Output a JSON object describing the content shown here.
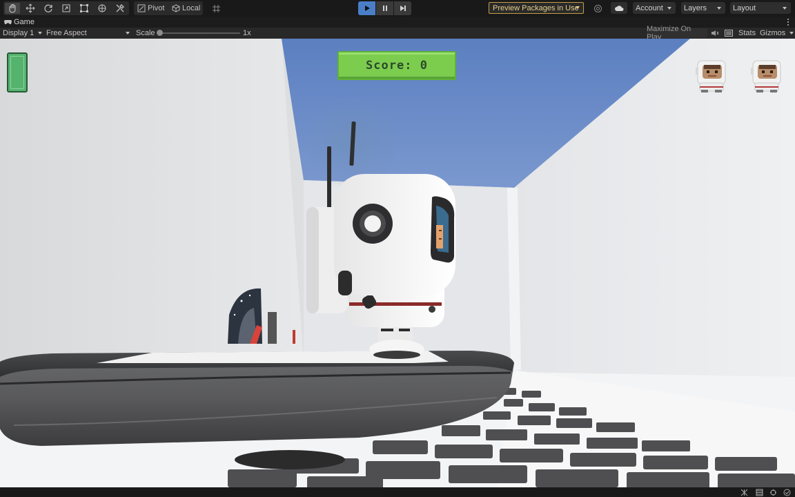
{
  "toolbar": {
    "tools": [
      "hand-tool",
      "move-tool",
      "rotate-tool",
      "scale-tool",
      "rect-tool",
      "transform-tool",
      "custom-tool"
    ],
    "pivot_label": "Pivot",
    "local_label": "Local",
    "preview_packages_label": "Preview Packages in Use",
    "account_label": "Account",
    "layers_label": "Layers",
    "layout_label": "Layout"
  },
  "tab": {
    "title": "Game"
  },
  "game_bar": {
    "display": "Display 1",
    "aspect": "Free Aspect",
    "scale_label": "Scale",
    "scale_value": "1x",
    "maximize_label": "Maximize On Play",
    "stats_label": "Stats",
    "gizmos_label": "Gizmos"
  },
  "hud": {
    "score_text": "Score: 0",
    "lives": 2,
    "battery_level": 1.0
  },
  "colors": {
    "play_active": "#4a7fc8",
    "score_bg": "#7ccd4e",
    "battery": "#55b36e",
    "preview_border": "#c7a047",
    "sky": "#6d8fc9"
  }
}
